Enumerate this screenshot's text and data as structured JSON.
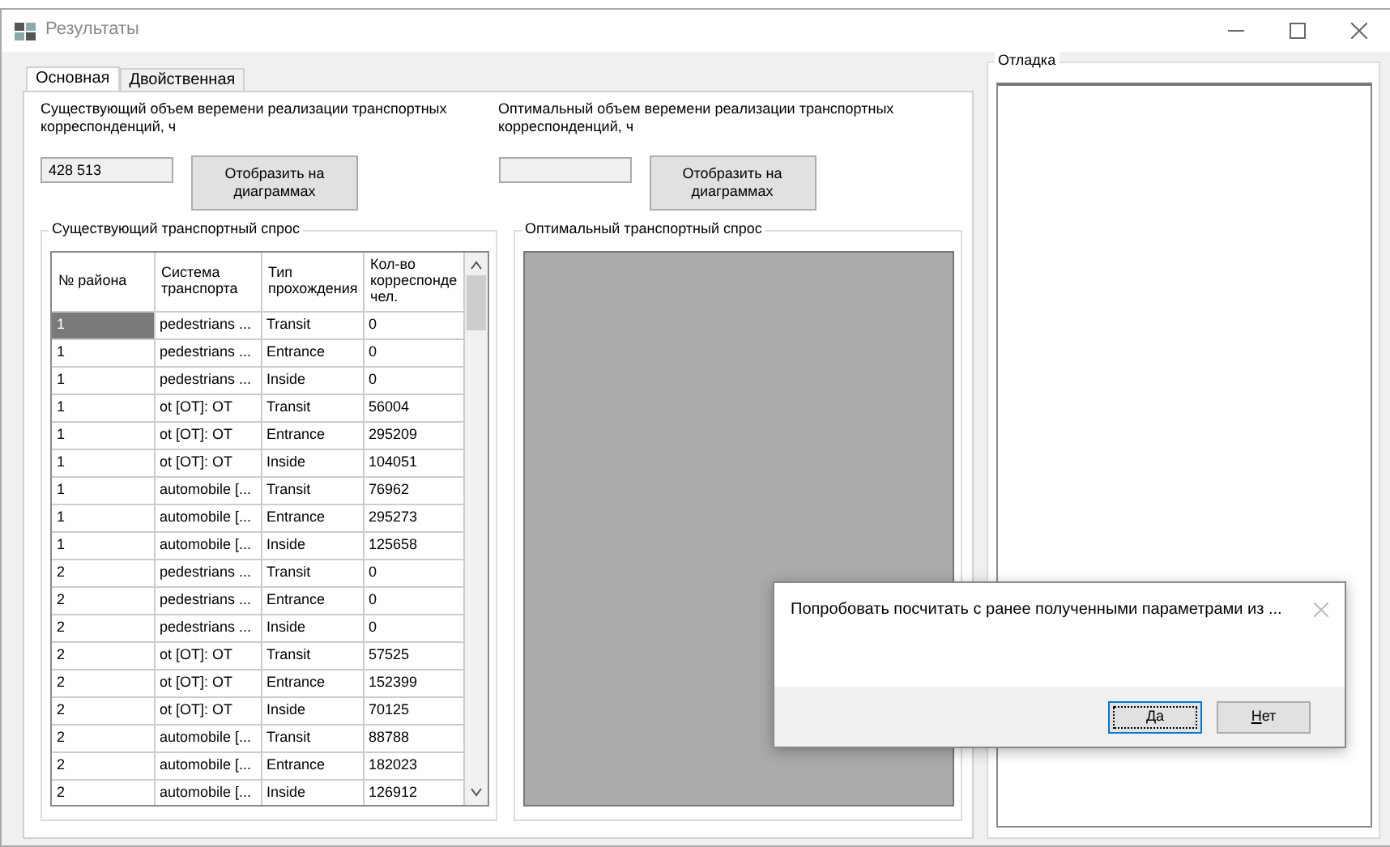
{
  "window": {
    "title": "Результаты"
  },
  "tabs": [
    {
      "label": "Основная",
      "selected": true
    },
    {
      "label": "Двойственная",
      "selected": false
    }
  ],
  "existing": {
    "label": "Существующий объем веремени реализации транспортных корреспонденций, ч",
    "value": "428 513",
    "button": "Отобразить на диаграммах"
  },
  "optimal": {
    "label": "Оптимальный объем веремени реализации транспортных корреспонденций, ч",
    "button": "Отобразить на диаграммах"
  },
  "existing_demand": {
    "title": "Существующий транспортный спрос",
    "columns": [
      "№ района",
      "Система транспорта",
      "Тип прохождения",
      "Кол-во корреспонде чел."
    ],
    "rows": [
      {
        "cells": [
          "1",
          "pedestrians ...",
          "Transit",
          "0"
        ],
        "selected": true
      },
      {
        "cells": [
          "1",
          "pedestrians ...",
          "Entrance",
          "0"
        ],
        "selected": false
      },
      {
        "cells": [
          "1",
          "pedestrians ...",
          "Inside",
          "0"
        ],
        "selected": false
      },
      {
        "cells": [
          "1",
          "ot [OT]: OT",
          "Transit",
          "56004"
        ],
        "selected": false
      },
      {
        "cells": [
          "1",
          "ot [OT]: OT",
          "Entrance",
          "295209"
        ],
        "selected": false
      },
      {
        "cells": [
          "1",
          "ot [OT]: OT",
          "Inside",
          "104051"
        ],
        "selected": false
      },
      {
        "cells": [
          "1",
          "automobile [...",
          "Transit",
          "76962"
        ],
        "selected": false
      },
      {
        "cells": [
          "1",
          "automobile [...",
          "Entrance",
          "295273"
        ],
        "selected": false
      },
      {
        "cells": [
          "1",
          "automobile [...",
          "Inside",
          "125658"
        ],
        "selected": false
      },
      {
        "cells": [
          "2",
          "pedestrians ...",
          "Transit",
          "0"
        ],
        "selected": false
      },
      {
        "cells": [
          "2",
          "pedestrians ...",
          "Entrance",
          "0"
        ],
        "selected": false
      },
      {
        "cells": [
          "2",
          "pedestrians ...",
          "Inside",
          "0"
        ],
        "selected": false
      },
      {
        "cells": [
          "2",
          "ot [OT]: OT",
          "Transit",
          "57525"
        ],
        "selected": false
      },
      {
        "cells": [
          "2",
          "ot [OT]: OT",
          "Entrance",
          "152399"
        ],
        "selected": false
      },
      {
        "cells": [
          "2",
          "ot [OT]: OT",
          "Inside",
          "70125"
        ],
        "selected": false
      },
      {
        "cells": [
          "2",
          "automobile [...",
          "Transit",
          "88788"
        ],
        "selected": false
      },
      {
        "cells": [
          "2",
          "automobile [...",
          "Entrance",
          "182023"
        ],
        "selected": false
      },
      {
        "cells": [
          "2",
          "automobile [...",
          "Inside",
          "126912"
        ],
        "selected": false
      }
    ]
  },
  "optimal_demand": {
    "title": "Оптимальный транспортный спрос"
  },
  "debug": {
    "title": "Отладка"
  },
  "dialog": {
    "message": "Попробовать посчитать с ранее полученными параметрами из ...",
    "buttons": [
      {
        "label": "Да",
        "focused": true
      },
      {
        "label": "Нет",
        "focused": false
      }
    ]
  }
}
